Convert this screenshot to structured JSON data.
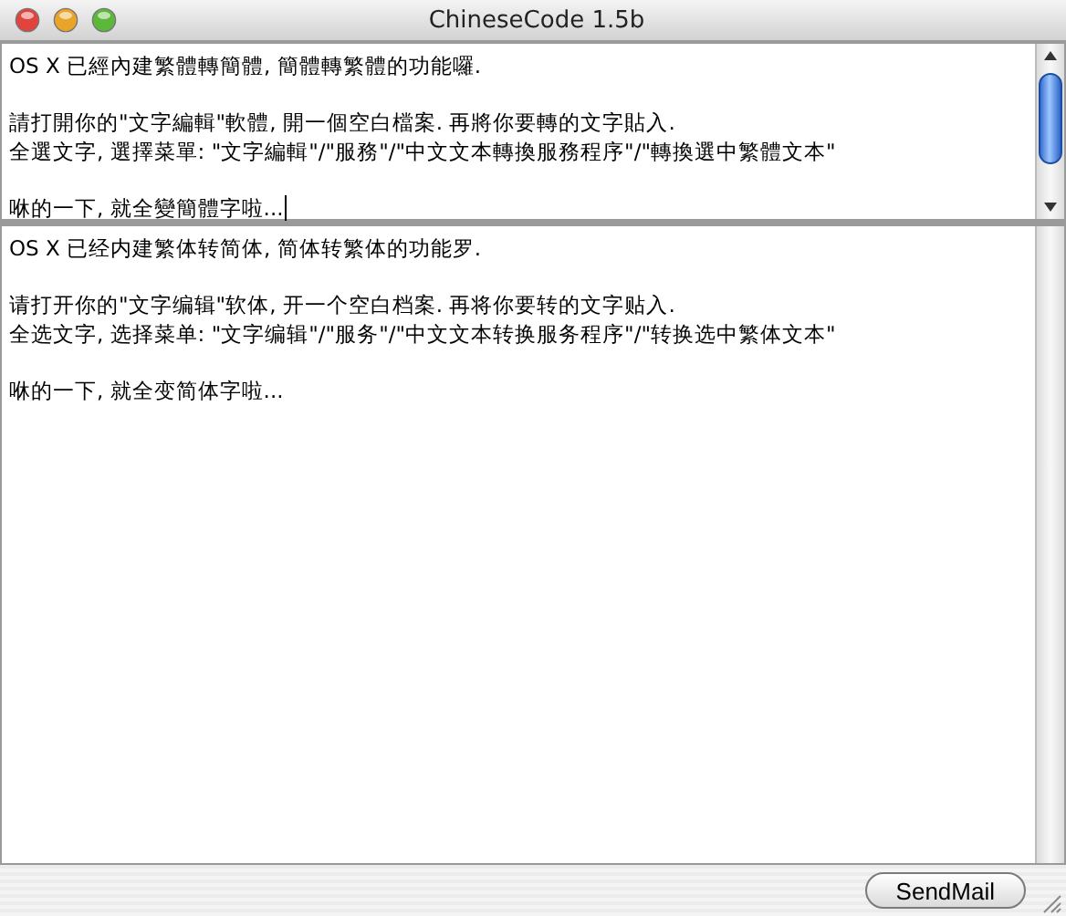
{
  "window": {
    "title": "ChineseCode 1.5b"
  },
  "source_pane": {
    "focused": true,
    "paragraphs": [
      [
        "OS X 已經內建繁體轉簡體, 簡體轉繁體的功能囉."
      ],
      [
        "請打開你的\"文字編輯\"軟體, 開一個空白檔案. 再將你要轉的文字貼入.",
        "全選文字, 選擇菜單: \"文字編輯\"/\"服務\"/\"中文文本轉換服務程序\"/\"轉換選中繁體文本\""
      ],
      [
        "咻的一下, 就全變簡體字啦..."
      ]
    ]
  },
  "result_pane": {
    "focused": false,
    "paragraphs": [
      [
        "OS X 已经内建繁体转简体, 简体转繁体的功能罗."
      ],
      [
        "请打开你的\"文字编辑\"软体, 开一个空白档案. 再将你要转的文字贴入.",
        "全选文字, 选择菜单: \"文字编辑\"/\"服务\"/\"中文文本转换服务程序\"/\"转换选中繁体文本\""
      ],
      [
        "咻的一下, 就全变简体字啦..."
      ]
    ]
  },
  "buttons": [
    "SendMail"
  ]
}
